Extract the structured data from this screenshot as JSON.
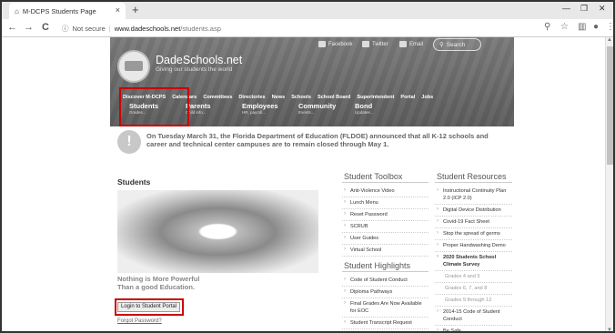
{
  "browser": {
    "tab_title": "M-DCPS Students Page",
    "tab_close": "×",
    "new_tab": "+",
    "minimize": "—",
    "maximize": "❐",
    "close": "✕",
    "back": "←",
    "forward": "→",
    "reload": "C",
    "security_label": "Not secure",
    "url_host": "www.dadeschools.net",
    "url_path": "/students.asp"
  },
  "header": {
    "site_name": "DadeSchools.net",
    "tagline": "Giving our students the world",
    "social": [
      "Facebook",
      "Twitter",
      "Email"
    ],
    "search_label": "Search",
    "top_nav": [
      "Discover M-DCPS",
      "Calendars",
      "Committees",
      "Directories",
      "News",
      "Schools",
      "School Board",
      "Superintendent",
      "Portal",
      "Jobs"
    ],
    "sub_nav": [
      {
        "label": "Students",
        "sub": "Grades..."
      },
      {
        "label": "Parents",
        "sub": "Child info..."
      },
      {
        "label": "Employees",
        "sub": "HR, payroll..."
      },
      {
        "label": "Community",
        "sub": "Events..."
      },
      {
        "label": "Bond",
        "sub": "Updates..."
      }
    ]
  },
  "announcement": {
    "icon": "!",
    "text": "On Tuesday March 31, the Florida Department of Education (FLDOE) announced that all K-12 schools and career and technical center campuses are to remain closed through May 1."
  },
  "main": {
    "heading": "Students",
    "motto_line1": "Nothing is More Powerful",
    "motto_line2": "Than a good Education.",
    "login_button": "Login to Student Portal",
    "forgot_link": "Forgot Password?"
  },
  "toolbox": {
    "title": "Student Toolbox",
    "items": [
      "Anti-Violence Video",
      "Lunch Menu",
      "Reset Password",
      "SCRUB",
      "User Guides",
      "Virtual School"
    ]
  },
  "highlights": {
    "title": "Student Highlights",
    "items": [
      "Code of Student Conduct",
      "Diploma Pathways",
      "Final Grades Are Now Available for EOC",
      "Student Transcript Request"
    ]
  },
  "resources": {
    "title": "Student Resources",
    "items": [
      {
        "text": "Instructional Continuity Plan 2.0 (ICP 2.0)",
        "style": ""
      },
      {
        "text": "Digital Device Distribution",
        "style": ""
      },
      {
        "text": "Covid-19 Fact Sheet",
        "style": ""
      },
      {
        "text": "Stop the spread of germs",
        "style": ""
      },
      {
        "text": "Proper Handwashing Demo",
        "style": ""
      },
      {
        "text": "2020 Students School Climate Survey",
        "style": "bold"
      },
      {
        "text": "Grades 4 and 5",
        "style": "grey"
      },
      {
        "text": "Grades 6, 7, and 8",
        "style": "grey"
      },
      {
        "text": "Grades 9 through 12",
        "style": "grey"
      },
      {
        "text": "2014-15 Code of Student Conduct",
        "style": ""
      },
      {
        "text": "Be Safe",
        "style": ""
      }
    ]
  }
}
